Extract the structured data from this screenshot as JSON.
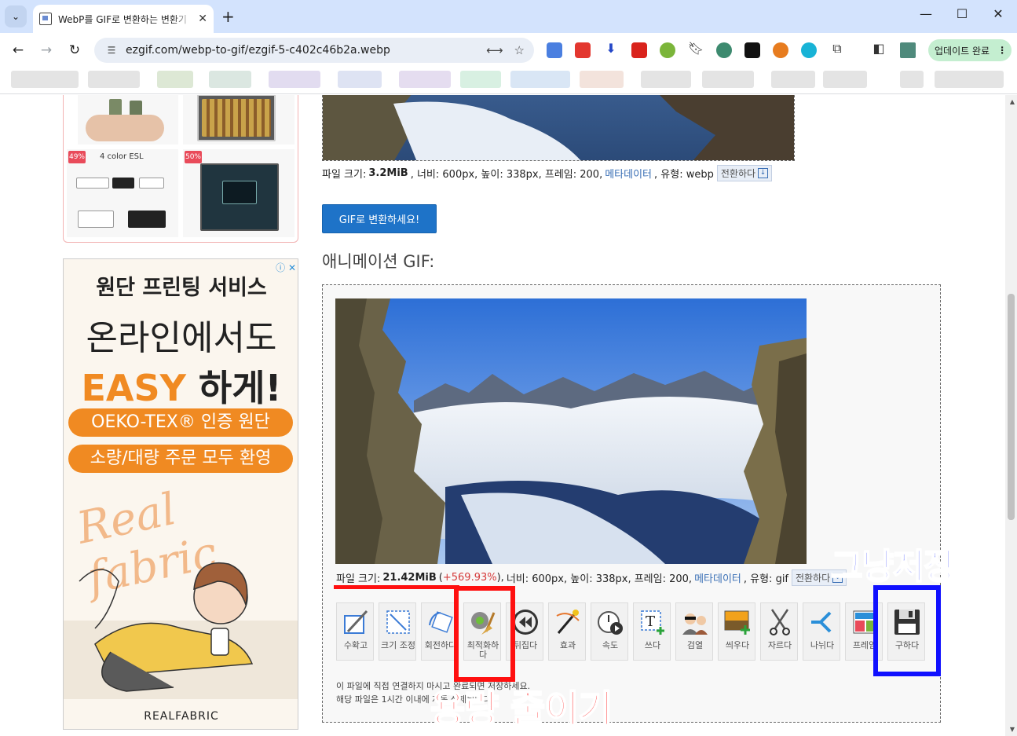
{
  "browser": {
    "tab_title": "WebP를 GIF로 변환하는 변환기",
    "url": "ezgif.com/webp-to-gif/ezgif-5-c402c46b2a.webp",
    "update_label": "업데이트 완료",
    "accent_color": "#d3e3fd"
  },
  "ads": {
    "products": [
      {
        "discount": "49%",
        "title": "4 color ESL"
      },
      {
        "discount": "50%",
        "title": ""
      }
    ],
    "banner": {
      "adchoice": "ⓘ ✕",
      "line1": "원단 프린팅 서비스",
      "line2": "온라인에서도",
      "line3_accent": "EASY",
      "line3_rest": " 하게!",
      "pill1": "OEKO-TEX® 인증 원단",
      "pill2": "소량/대량 주문 모두 환영",
      "script": "Real fabric",
      "logo": "REALFABRIC"
    }
  },
  "source": {
    "info_prefix": "파일 크기:",
    "size": "3.2MiB",
    "info_mid": ", 너비: 600px, 높이: 338px, 프레임: 200,",
    "metadata": "메타데이터",
    "info_type": ", 유형: webp",
    "convert": "전환하다"
  },
  "convert_button": "GIF로 변환하세요!",
  "anim_title": "애니메이션 GIF:",
  "output": {
    "info_prefix": "파일 크기:",
    "size": "21.42MiB",
    "pct_open": "(",
    "pct": "+569.93%",
    "pct_close": "),",
    "info_mid": "너비: 600px, 높이: 338px, 프레임: 200,",
    "metadata": "메타데이터",
    "info_type": ", 유형: gif",
    "convert": "전환하다"
  },
  "tools": [
    {
      "id": "crop",
      "label": "수확고",
      "icon": "crop-icon"
    },
    {
      "id": "resize",
      "label": "크기 조정",
      "icon": "resize-icon"
    },
    {
      "id": "rotate",
      "label": "회전하다",
      "icon": "rotate-icon"
    },
    {
      "id": "optimize",
      "label": "최적화하다",
      "icon": "optimize-broom-icon"
    },
    {
      "id": "reverse",
      "label": "뒤집다",
      "icon": "rewind-icon"
    },
    {
      "id": "effects",
      "label": "효과",
      "icon": "magic-wand-icon"
    },
    {
      "id": "speed",
      "label": "속도",
      "icon": "stopwatch-icon"
    },
    {
      "id": "write",
      "label": "쓰다",
      "icon": "text-icon"
    },
    {
      "id": "censor",
      "label": "검열",
      "icon": "censor-icon"
    },
    {
      "id": "overlay",
      "label": "씌우다",
      "icon": "overlay-image-icon"
    },
    {
      "id": "cut",
      "label": "자르다",
      "icon": "scissors-icon"
    },
    {
      "id": "split",
      "label": "나뉘다",
      "icon": "split-icon"
    },
    {
      "id": "frames",
      "label": "프레임",
      "icon": "frames-icon"
    },
    {
      "id": "save",
      "label": "구하다",
      "icon": "save-disk-icon"
    }
  ],
  "notes": {
    "line1": "이 파일에 직접 연결하지 마시고 완료되면 저장하세요.",
    "line2": "해당 파일은 1시간 이내에 자동 삭제됩니다."
  },
  "annotations": {
    "blue_label": "그냥저장",
    "red_label": "용량 줄이기",
    "red_color": "#ff1010",
    "blue_color": "#1010ff"
  }
}
